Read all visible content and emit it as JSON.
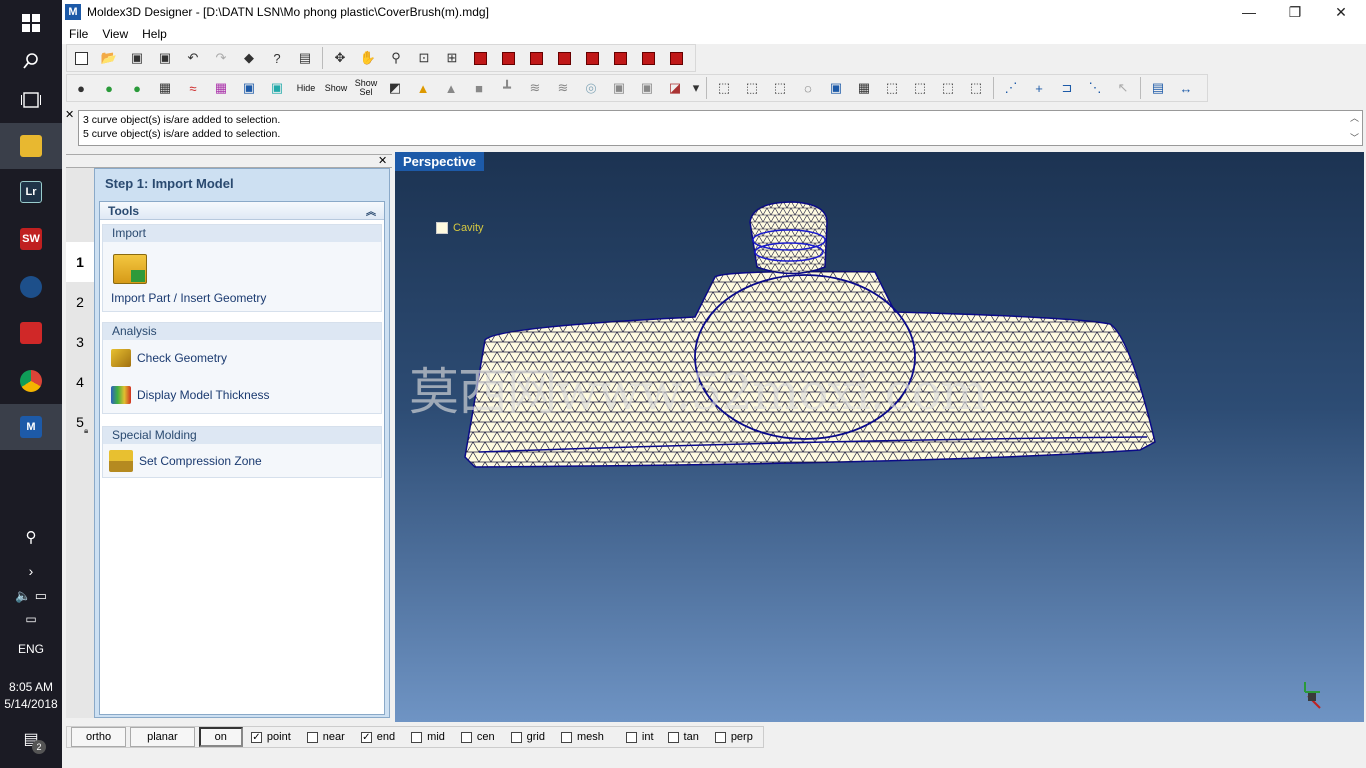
{
  "taskbar": {
    "time": "8:05 AM",
    "date": "5/14/2018",
    "language": "ENG",
    "notification_count": "2",
    "apps": [
      {
        "name": "file-explorer",
        "label": ""
      },
      {
        "name": "lightroom",
        "label": "Lr"
      },
      {
        "name": "solidworks",
        "label": "SW"
      },
      {
        "name": "steam",
        "label": ""
      },
      {
        "name": "app5",
        "label": ""
      },
      {
        "name": "chrome",
        "label": ""
      },
      {
        "name": "moldex3d",
        "label": "M"
      }
    ]
  },
  "window": {
    "title": "Moldex3D Designer - [D:\\DATN LSN\\Mo phong plastic\\CoverBrush(m).mdg]",
    "icon": "M"
  },
  "menu": [
    "File",
    "View",
    "Help"
  ],
  "toolbar2": {
    "hide": "Hide",
    "show": "Show",
    "show_sel": "Show\nSel"
  },
  "messages": [
    "3 curve object(s) is/are added to selection.",
    "5 curve object(s) is/are added to selection."
  ],
  "panel": {
    "step_title": "Step 1: Import Model",
    "tools_title": "Tools",
    "steps": [
      "1",
      "2",
      "3",
      "4",
      "5"
    ],
    "groups": {
      "import": "Import",
      "analysis": "Analysis",
      "special": "Special Molding"
    },
    "tools": {
      "import_part": "Import Part / Insert Geometry",
      "check_geometry": "Check Geometry",
      "display_thickness": "Display Model Thickness",
      "compression_zone": "Set Compression Zone"
    }
  },
  "viewport": {
    "label": "Perspective",
    "legend": "Cavity",
    "watermark": "莫西网www.52moxi.com"
  },
  "snapbar": {
    "ortho": "ortho",
    "planar": "planar",
    "on": "on",
    "options": [
      {
        "label": "point",
        "checked": true
      },
      {
        "label": "near",
        "checked": false
      },
      {
        "label": "end",
        "checked": true
      },
      {
        "label": "mid",
        "checked": false
      },
      {
        "label": "cen",
        "checked": false
      },
      {
        "label": "grid",
        "checked": false
      },
      {
        "label": "mesh",
        "checked": false
      },
      {
        "label": "int",
        "checked": false
      },
      {
        "label": "tan",
        "checked": false
      },
      {
        "label": "perp",
        "checked": false
      }
    ]
  },
  "colors": {
    "accent": "#1d5aa8",
    "panel_bg": "#cde0f2",
    "model_fill": "#fffbe0",
    "mesh_line": "#1a1a3a"
  }
}
